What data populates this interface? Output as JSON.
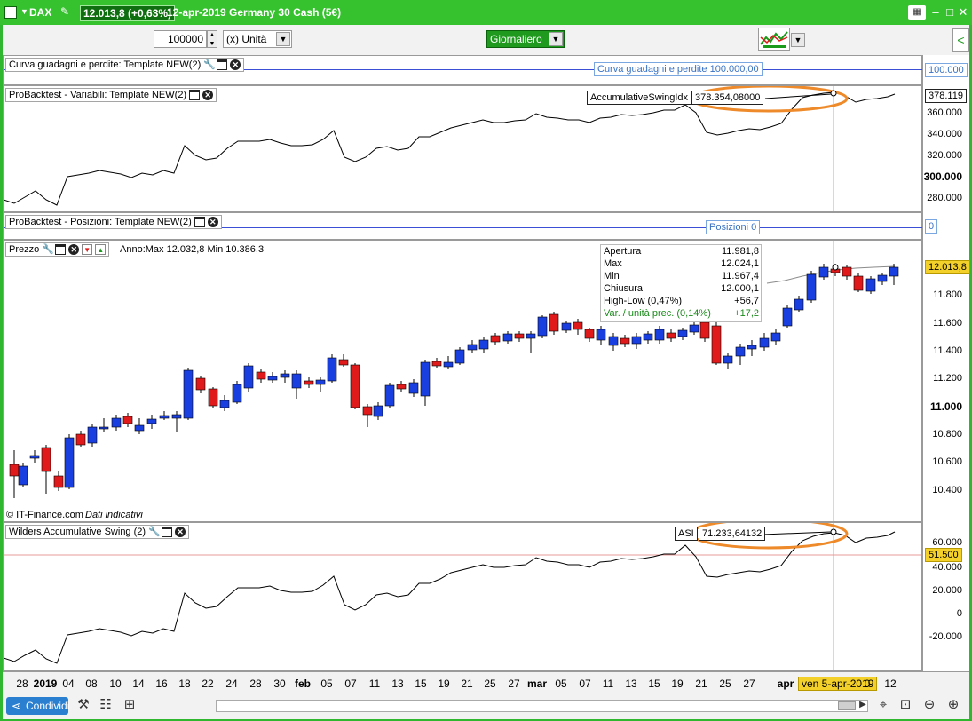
{
  "header": {
    "symbol": "DAX",
    "price": "12.013,8 (+0,63%)",
    "info": "12-apr-2019 Germany 30 Cash (5€)"
  },
  "toolbar": {
    "quantity": "100000",
    "unit": "(x) Unità",
    "timeframe": "Giornaliero"
  },
  "panels": {
    "equity": {
      "label": "Curva guadagni e perdite: Template NEW(2)",
      "value_tag": "Curva guadagni e perdite   100.000,00",
      "axis_tag": "100.000"
    },
    "vars": {
      "label": "ProBacktest - Variabili: Template NEW(2)",
      "tag_name": "AccumulativeSwingIdx",
      "tag_value": "378.354,08000",
      "axis_tag": "378.119",
      "ticks": [
        "360.000",
        "340.000",
        "320.000",
        "300.000",
        "280.000"
      ]
    },
    "positions": {
      "label": "ProBacktest - Posizioni: Template NEW(2)",
      "value_tag": "Posizioni   0",
      "axis_tag": "0"
    },
    "price": {
      "label": "Prezzo",
      "range": "Anno:Max 12.032,8 Min 10.386,3",
      "axis_tag": "12.013,8",
      "ticks": [
        "11.800",
        "11.600",
        "11.400",
        "11.200",
        "11.000",
        "10.800",
        "10.600",
        "10.400"
      ],
      "copyright": "© IT-Finance.com",
      "disclaimer": "Dati indicativi"
    },
    "asi": {
      "label": "Wilders Accumulative Swing (2)",
      "tag_name": "ASI",
      "tag_value": "71.233,64132",
      "axis_tag": "51.500",
      "ticks": [
        "60.000",
        "40.000",
        "20.000",
        "0",
        "-20.000"
      ]
    }
  },
  "infobox": [
    {
      "label": "Apertura",
      "value": "11.981,8"
    },
    {
      "label": "Max",
      "value": "12.024,1"
    },
    {
      "label": "Min",
      "value": "11.967,4"
    },
    {
      "label": "Chiusura",
      "value": "12.000,1"
    },
    {
      "label": "High-Low (0,47%)",
      "value": "+56,7"
    },
    {
      "label": "Var. / unità prec. (0,14%)",
      "value": "+17,2"
    }
  ],
  "xaxis": {
    "labels": [
      "28",
      "2019",
      "04",
      "08",
      "10",
      "14",
      "16",
      "18",
      "22",
      "24",
      "28",
      "30",
      "feb",
      "05",
      "07",
      "11",
      "13",
      "15",
      "19",
      "21",
      "25",
      "27",
      "mar",
      "05",
      "07",
      "11",
      "13",
      "15",
      "19",
      "21",
      "25",
      "27",
      "apr",
      "0",
      "12"
    ],
    "cursor_date": "ven 5-apr-2019"
  },
  "bottom": {
    "share_label": "Condividi"
  },
  "colors": {
    "up": "#1a3fe0",
    "down": "#e01a1a",
    "window": "#36c12f",
    "highlight": "#ee8a2a"
  }
}
